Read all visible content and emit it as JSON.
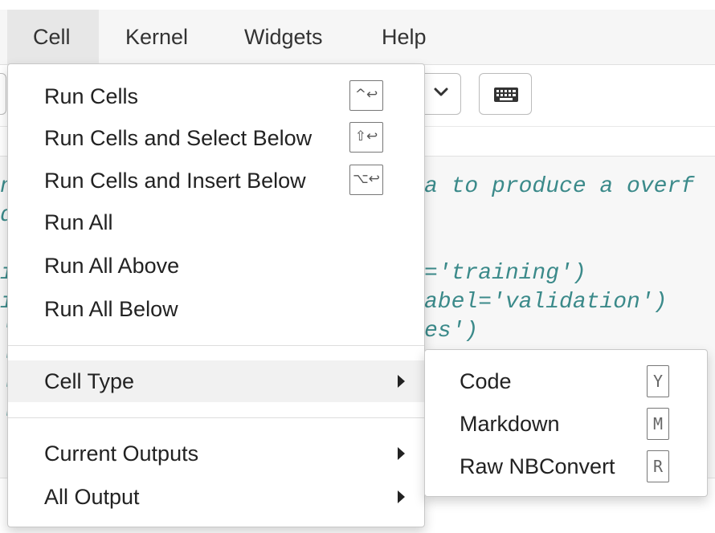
{
  "menubar": {
    "items": [
      {
        "label": "Cell"
      },
      {
        "label": "Kernel"
      },
      {
        "label": "Widgets"
      },
      {
        "label": "Help"
      }
    ]
  },
  "toolbar": {
    "cell_type_select_icon": "chevron-down-icon",
    "keyboard_button_icon": "keyboard-icon"
  },
  "code": {
    "lines": [
      "n",
      "d",
      "i",
      "i",
      "'",
      "'",
      "'",
      "'",
      "a to produce a overf",
      "='training')",
      "abel='validation')",
      "es')"
    ]
  },
  "cell_menu": {
    "run_cells": {
      "label": "Run Cells",
      "shortcut": "^↩"
    },
    "run_select_below": {
      "label": "Run Cells and Select Below",
      "shortcut": "⇧↩"
    },
    "run_insert_below": {
      "label": "Run Cells and Insert Below",
      "shortcut": "⌥↩"
    },
    "run_all": {
      "label": "Run All"
    },
    "run_all_above": {
      "label": "Run All Above"
    },
    "run_all_below": {
      "label": "Run All Below"
    },
    "cell_type": {
      "label": "Cell Type"
    },
    "current_outputs": {
      "label": "Current Outputs"
    },
    "all_output": {
      "label": "All Output"
    }
  },
  "cell_type_submenu": {
    "code": {
      "label": "Code",
      "shortcut": "Y"
    },
    "markdown": {
      "label": "Markdown",
      "shortcut": "M"
    },
    "raw": {
      "label": "Raw NBConvert",
      "shortcut": "R"
    }
  }
}
